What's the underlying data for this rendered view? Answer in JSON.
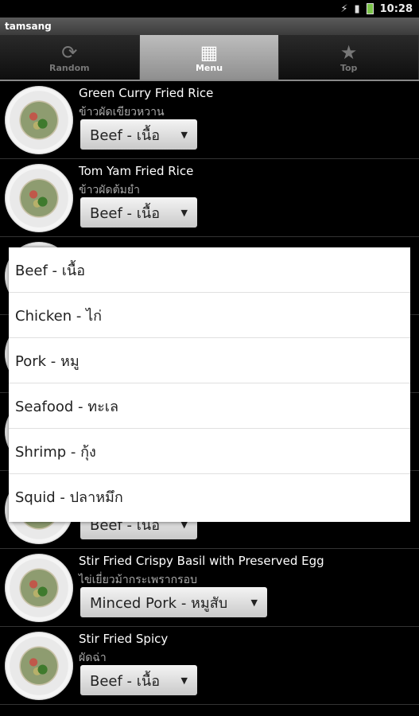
{
  "status": {
    "time": "10:28"
  },
  "app": {
    "title": "tamsang"
  },
  "tabs": [
    {
      "label": "Random",
      "icon": "refresh-icon",
      "active": false
    },
    {
      "label": "Menu",
      "icon": "book-icon",
      "active": true
    },
    {
      "label": "Top",
      "icon": "star-icon",
      "active": false
    }
  ],
  "rows": [
    {
      "name_en": "Green Curry Fried Rice",
      "name_th": "ข้าวผัดเขียวหวาน",
      "selected": "Beef - เนื้อ"
    },
    {
      "name_en": "Tom Yam Fried Rice",
      "name_th": "ข้าวผัดต้มยำ",
      "selected": "Beef - เนื้อ"
    },
    {
      "name_en": "",
      "name_th": "",
      "selected": ""
    },
    {
      "name_en": "",
      "name_th": "",
      "selected": ""
    },
    {
      "name_en": "",
      "name_th": "",
      "selected": ""
    },
    {
      "name_en": "",
      "name_th": "",
      "selected": "Beef - เนื้อ"
    },
    {
      "name_en": "Stir Fried Crispy Basil with Preserved Egg",
      "name_th": "ไข่เยี่ยวม้ากระเพรากรอบ",
      "selected": "Minced Pork - หมูสับ"
    },
    {
      "name_en": "Stir Fried Spicy",
      "name_th": "ผัดฉ่า",
      "selected": "Beef - เนื้อ"
    }
  ],
  "dropdown": {
    "options": [
      "Beef - เนื้อ",
      "Chicken - ไก่",
      "Pork - หมู",
      "Seafood - ทะเล",
      "Shrimp - กุ้ง",
      "Squid - ปลาหมึก"
    ]
  }
}
